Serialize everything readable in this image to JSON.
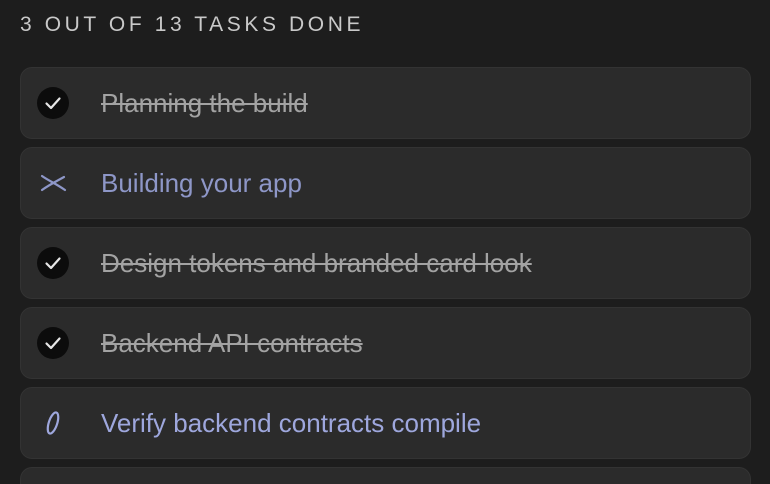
{
  "header": {
    "progress_text": "3 out of 13 tasks done",
    "done": 3,
    "total": 13
  },
  "colors": {
    "background": "#1d1d1d",
    "card": "#2b2b2b",
    "done_text": "#a3a3a3",
    "active_text": "#8e97c8",
    "accent": "#9ea7dd"
  },
  "tasks": [
    {
      "label": "Planning the build",
      "status": "done",
      "icon": "check-circle-icon"
    },
    {
      "label": "Building your app",
      "status": "in-progress",
      "icon": "sparkle-x-icon"
    },
    {
      "label": "Design tokens and branded card look",
      "status": "done",
      "icon": "check-circle-icon"
    },
    {
      "label": "Backend API contracts",
      "status": "done",
      "icon": "check-circle-icon"
    },
    {
      "label": "Verify backend contracts compile",
      "status": "in-progress",
      "icon": "spinner-icon"
    }
  ]
}
